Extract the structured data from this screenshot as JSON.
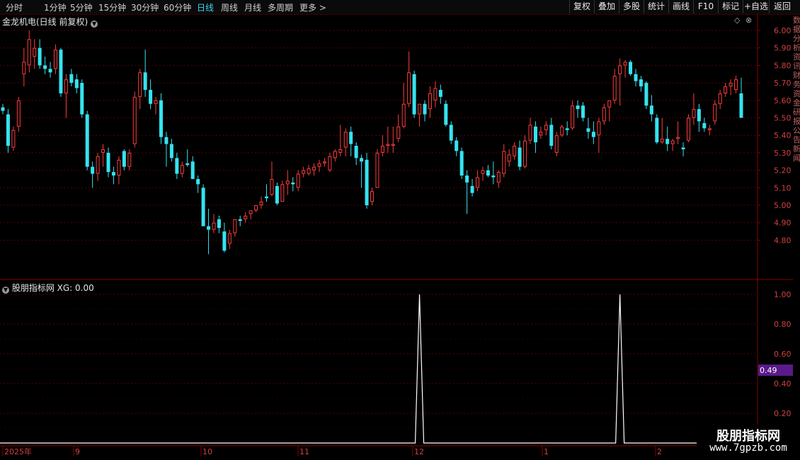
{
  "toolbar": {
    "periods": [
      "分时",
      "1分钟",
      "5分钟",
      "15分钟",
      "30分钟",
      "60分钟",
      "日线",
      "周线",
      "月线",
      "多周期",
      "更多 >"
    ],
    "active_period": "日线",
    "buttons": [
      "复权",
      "叠加",
      "多股",
      "统计",
      "画线",
      "F10",
      "标记",
      "+自选",
      "返回"
    ]
  },
  "main_chart": {
    "title": "金龙机电(日线 前复权)",
    "diamond_icon": "◇",
    "close_icon": "⊗"
  },
  "indicator": {
    "title": "股朋指标网 XG: 0.00",
    "cursor_value": "0.49"
  },
  "time_axis": [
    "2025年",
    "9",
    "10",
    "11",
    "12",
    "1",
    "2"
  ],
  "watermark": {
    "name": "股朋指标网",
    "url": "www.7gpzb.com"
  },
  "right_strip_text": "数据分析资讯财务资金研报公告新闻",
  "colors": {
    "up": "#ff3b3b",
    "down": "#34e3f0",
    "grid": "#5a0000",
    "selection": "#5b1a8a"
  },
  "chart_data": [
    {
      "type": "candlestick",
      "title": "金龙机电(日线 前复权)",
      "y_ticks": [
        "6.00",
        "5.90",
        "5.80",
        "5.70",
        "5.60",
        "5.50",
        "5.40",
        "5.30",
        "5.20",
        "5.10",
        "5.00",
        "4.90",
        "4.80"
      ],
      "ylim": [
        4.68,
        6.05
      ],
      "x_labels": [
        "2025年",
        "9",
        "10",
        "11",
        "12",
        "1",
        "2"
      ],
      "candles": [
        [
          5.56,
          5.58,
          5.52,
          5.54
        ],
        [
          5.52,
          5.55,
          5.3,
          5.34
        ],
        [
          5.33,
          5.45,
          5.31,
          5.43
        ],
        [
          5.45,
          5.62,
          5.42,
          5.6
        ],
        [
          5.75,
          5.9,
          5.68,
          5.82
        ],
        [
          5.8,
          6.0,
          5.76,
          5.95
        ],
        [
          5.85,
          5.95,
          5.78,
          5.9
        ],
        [
          5.9,
          5.95,
          5.78,
          5.8
        ],
        [
          5.8,
          5.85,
          5.75,
          5.78
        ],
        [
          5.78,
          5.82,
          5.73,
          5.76
        ],
        [
          5.78,
          5.92,
          5.75,
          5.89
        ],
        [
          5.89,
          5.9,
          5.62,
          5.64
        ],
        [
          5.64,
          5.75,
          5.5,
          5.72
        ],
        [
          5.75,
          5.78,
          5.68,
          5.7
        ],
        [
          5.72,
          5.75,
          5.64,
          5.67
        ],
        [
          5.7,
          5.72,
          5.5,
          5.52
        ],
        [
          5.52,
          5.54,
          5.2,
          5.22
        ],
        [
          5.22,
          5.25,
          5.1,
          5.18
        ],
        [
          5.18,
          5.3,
          5.14,
          5.28
        ],
        [
          5.3,
          5.35,
          5.22,
          5.32
        ],
        [
          5.3,
          5.33,
          5.16,
          5.19
        ],
        [
          5.19,
          5.22,
          5.12,
          5.17
        ],
        [
          5.17,
          5.28,
          5.12,
          5.26
        ],
        [
          5.31,
          5.32,
          5.2,
          5.22
        ],
        [
          5.22,
          5.32,
          5.2,
          5.3
        ],
        [
          5.35,
          5.65,
          5.33,
          5.62
        ],
        [
          5.62,
          5.78,
          5.55,
          5.76
        ],
        [
          5.76,
          5.89,
          5.62,
          5.66
        ],
        [
          5.66,
          5.72,
          5.55,
          5.58
        ],
        [
          5.58,
          5.62,
          5.52,
          5.6
        ],
        [
          5.6,
          5.64,
          5.35,
          5.39
        ],
        [
          5.39,
          5.42,
          5.22,
          5.35
        ],
        [
          5.35,
          5.38,
          5.25,
          5.27
        ],
        [
          5.27,
          5.3,
          5.15,
          5.18
        ],
        [
          5.18,
          5.25,
          5.16,
          5.23
        ],
        [
          5.24,
          5.32,
          5.22,
          5.23
        ],
        [
          5.25,
          5.28,
          5.15,
          5.15
        ],
        [
          5.15,
          5.17,
          5.07,
          5.12
        ],
        [
          5.1,
          5.12,
          4.93,
          4.88
        ],
        [
          4.88,
          4.98,
          4.72,
          4.86
        ],
        [
          4.86,
          4.95,
          4.84,
          4.9
        ],
        [
          4.92,
          4.94,
          4.84,
          4.87
        ],
        [
          4.85,
          4.9,
          4.73,
          4.74
        ],
        [
          4.78,
          4.86,
          4.75,
          4.84
        ],
        [
          4.84,
          4.92,
          4.82,
          4.92
        ],
        [
          4.92,
          4.94,
          4.88,
          4.91
        ],
        [
          4.92,
          4.96,
          4.9,
          4.94
        ],
        [
          4.95,
          4.97,
          4.92,
          4.97
        ],
        [
          4.97,
          5.0,
          4.96,
          5.0
        ],
        [
          5.0,
          5.05,
          4.98,
          5.02
        ],
        [
          5.05,
          5.12,
          5.02,
          5.04
        ],
        [
          5.06,
          5.25,
          5.05,
          5.15
        ],
        [
          5.11,
          5.13,
          5.0,
          5.01
        ],
        [
          5.02,
          5.14,
          5.02,
          5.12
        ],
        [
          5.12,
          5.2,
          5.06,
          5.14
        ],
        [
          5.13,
          5.16,
          5.08,
          5.12
        ],
        [
          5.1,
          5.2,
          5.08,
          5.18
        ],
        [
          5.18,
          5.22,
          5.16,
          5.2
        ],
        [
          5.18,
          5.23,
          5.17,
          5.21
        ],
        [
          5.2,
          5.24,
          5.17,
          5.22
        ],
        [
          5.22,
          5.26,
          5.19,
          5.24
        ],
        [
          5.24,
          5.27,
          5.22,
          5.25
        ],
        [
          5.2,
          5.3,
          5.19,
          5.28
        ],
        [
          5.27,
          5.32,
          5.25,
          5.31
        ],
        [
          5.3,
          5.46,
          5.28,
          5.32
        ],
        [
          5.33,
          5.44,
          5.28,
          5.42
        ],
        [
          5.42,
          5.45,
          5.28,
          5.35
        ],
        [
          5.34,
          5.36,
          5.23,
          5.27
        ],
        [
          5.27,
          5.29,
          5.1,
          5.25
        ],
        [
          5.26,
          5.3,
          4.98,
          5.0
        ],
        [
          5.02,
          5.1,
          5.0,
          5.08
        ],
        [
          5.1,
          5.32,
          5.1,
          5.3
        ],
        [
          5.3,
          5.4,
          5.28,
          5.34
        ],
        [
          5.34,
          5.45,
          5.3,
          5.35
        ],
        [
          5.34,
          5.45,
          5.3,
          5.35
        ],
        [
          5.38,
          5.52,
          5.36,
          5.45
        ],
        [
          5.45,
          5.7,
          5.44,
          5.58
        ],
        [
          5.58,
          5.88,
          5.56,
          5.76
        ],
        [
          5.75,
          5.77,
          5.5,
          5.52
        ],
        [
          5.52,
          5.56,
          5.45,
          5.58
        ],
        [
          5.58,
          5.6,
          5.48,
          5.52
        ],
        [
          5.55,
          5.68,
          5.5,
          5.64
        ],
        [
          5.6,
          5.71,
          5.56,
          5.67
        ],
        [
          5.66,
          5.69,
          5.58,
          5.62
        ],
        [
          5.58,
          5.6,
          5.45,
          5.46
        ],
        [
          5.46,
          5.48,
          5.35,
          5.37
        ],
        [
          5.37,
          5.39,
          5.28,
          5.31
        ],
        [
          5.31,
          5.33,
          5.15,
          5.17
        ],
        [
          5.17,
          5.2,
          4.95,
          5.13
        ],
        [
          5.11,
          5.15,
          5.05,
          5.07
        ],
        [
          5.1,
          5.2,
          5.08,
          5.16
        ],
        [
          5.18,
          5.22,
          5.14,
          5.2
        ],
        [
          5.2,
          5.23,
          5.16,
          5.17
        ],
        [
          5.17,
          5.25,
          5.12,
          5.16
        ],
        [
          5.13,
          5.2,
          5.1,
          5.19
        ],
        [
          5.18,
          5.35,
          5.16,
          5.31
        ],
        [
          5.25,
          5.32,
          5.22,
          5.29
        ],
        [
          5.28,
          5.36,
          5.26,
          5.34
        ],
        [
          5.33,
          5.37,
          5.2,
          5.22
        ],
        [
          5.22,
          5.4,
          5.21,
          5.37
        ],
        [
          5.37,
          5.5,
          5.35,
          5.46
        ],
        [
          5.45,
          5.48,
          5.3,
          5.36
        ],
        [
          5.4,
          5.45,
          5.38,
          5.42
        ],
        [
          5.43,
          5.48,
          5.4,
          5.46
        ],
        [
          5.46,
          5.5,
          5.32,
          5.34
        ],
        [
          5.3,
          5.42,
          5.28,
          5.4
        ],
        [
          5.4,
          5.46,
          5.39,
          5.45
        ],
        [
          5.44,
          5.48,
          5.4,
          5.43
        ],
        [
          5.44,
          5.6,
          5.43,
          5.57
        ],
        [
          5.57,
          5.6,
          5.5,
          5.55
        ],
        [
          5.57,
          5.59,
          5.48,
          5.5
        ],
        [
          5.44,
          5.5,
          5.38,
          5.42
        ],
        [
          5.42,
          5.48,
          5.35,
          5.39
        ],
        [
          5.4,
          5.5,
          5.3,
          5.48
        ],
        [
          5.48,
          5.58,
          5.46,
          5.56
        ],
        [
          5.56,
          5.6,
          5.48,
          5.6
        ],
        [
          5.6,
          5.78,
          5.58,
          5.74
        ],
        [
          5.75,
          5.84,
          5.57,
          5.8
        ],
        [
          5.8,
          5.83,
          5.73,
          5.82
        ],
        [
          5.82,
          5.83,
          5.74,
          5.75
        ],
        [
          5.75,
          5.78,
          5.68,
          5.71
        ],
        [
          5.72,
          5.74,
          5.65,
          5.68
        ],
        [
          5.7,
          5.71,
          5.55,
          5.57
        ],
        [
          5.57,
          5.63,
          5.48,
          5.52
        ],
        [
          5.5,
          5.52,
          5.35,
          5.36
        ],
        [
          5.36,
          5.5,
          5.35,
          5.38
        ],
        [
          5.38,
          5.45,
          5.31,
          5.35
        ],
        [
          5.35,
          5.38,
          5.31,
          5.37
        ],
        [
          5.38,
          5.48,
          5.35,
          5.39
        ],
        [
          5.33,
          5.36,
          5.28,
          5.32
        ],
        [
          5.37,
          5.52,
          5.36,
          5.5
        ],
        [
          5.5,
          5.64,
          5.46,
          5.55
        ],
        [
          5.55,
          5.58,
          5.42,
          5.48
        ],
        [
          5.47,
          5.5,
          5.42,
          5.44
        ],
        [
          5.43,
          5.46,
          5.4,
          5.44
        ],
        [
          5.48,
          5.6,
          5.46,
          5.58
        ],
        [
          5.58,
          5.66,
          5.55,
          5.64
        ],
        [
          5.64,
          5.7,
          5.62,
          5.68
        ],
        [
          5.68,
          5.72,
          5.63,
          5.7
        ],
        [
          5.66,
          5.74,
          5.64,
          5.72
        ],
        [
          5.64,
          5.73,
          5.5,
          5.5
        ]
      ]
    },
    {
      "type": "line",
      "title": "股朋指标网 XG",
      "series_name": "XG",
      "y_ticks": [
        "1.00",
        "0.80",
        "0.60",
        "0.40",
        "0.20"
      ],
      "ylim": [
        0,
        1
      ],
      "spikes_at_candle_index": [
        79,
        117
      ],
      "cursor_value": "0.49"
    }
  ]
}
